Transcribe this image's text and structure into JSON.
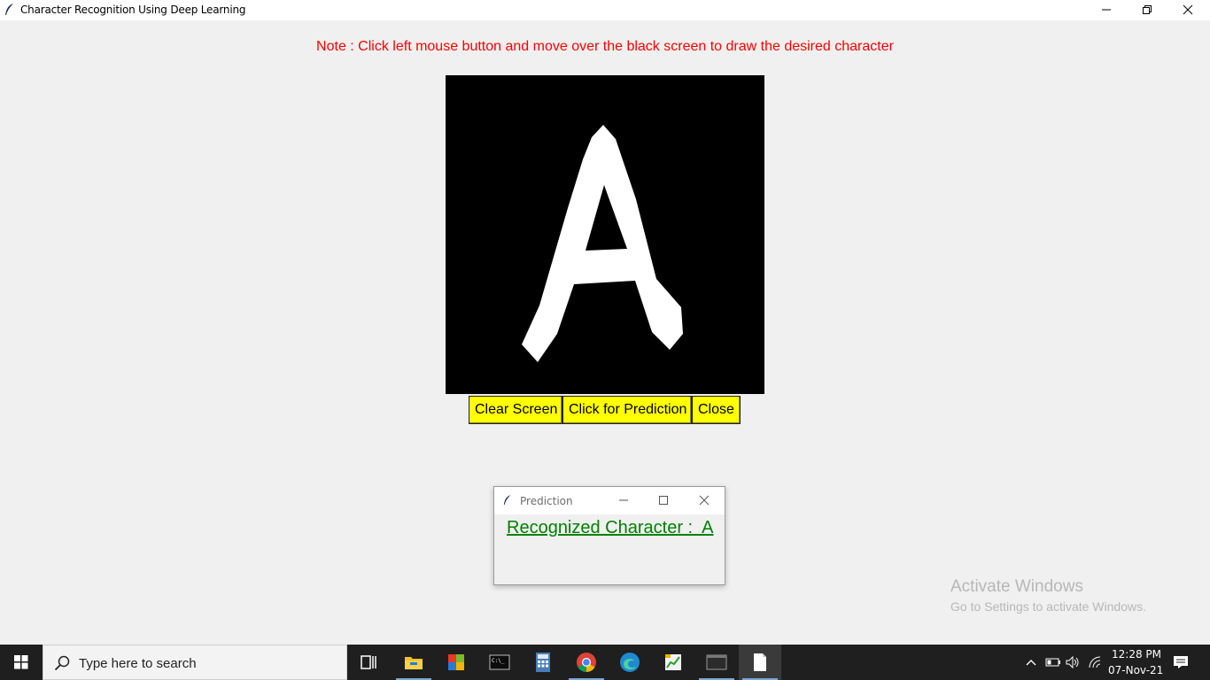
{
  "window": {
    "title": "Character Recognition Using Deep Learning"
  },
  "note": "Note : Click left mouse button and move over the black screen to draw the desired character",
  "buttons": {
    "clear": "Clear Screen",
    "predict": "Click for Prediction",
    "close": "Close"
  },
  "drawn_character": "A",
  "prediction": {
    "window_title": "Prediction",
    "result_text": "Recognized Character :  A"
  },
  "watermark": {
    "line1": "Activate Windows",
    "line2": "Go to Settings to activate Windows."
  },
  "taskbar": {
    "search_placeholder": "Type here to search",
    "pinned_icons": [
      "task-view-icon",
      "file-explorer-icon",
      "office-icon",
      "terminal-icon",
      "calculator-icon",
      "chrome-icon",
      "edge-icon",
      "chart-app-icon",
      "console-icon",
      "notepad-icon"
    ],
    "time": "12:28 PM",
    "date": "07-Nov-21"
  },
  "colors": {
    "note": "#ff0000",
    "button_bg": "#ffff00",
    "result_text": "#008000",
    "canvas_bg": "#000000",
    "stroke": "#ffffff"
  }
}
